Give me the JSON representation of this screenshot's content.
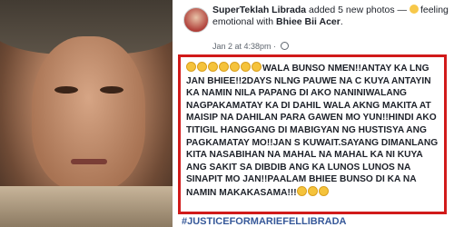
{
  "post": {
    "author": "SuperTeklah Librada",
    "action": "added 5 new photos",
    "feeling_prefix": "—",
    "feeling": "feeling emotional with",
    "tagged": "Bhiee Bii Acer",
    "timestamp": "Jan 2 at 4:38pm ·",
    "body": "WALA BUNSO NMEN!!ANTAY KA LNG JAN BHIEE!!2DAYS NLNG PAUWE NA C KUYA ANTAYIN KA NAMIN NILA PAPANG DI AKO NANINIWALANG NAGPAKAMATAY KA DI DAHIL WALA AKNG MAKITA AT MAISIP NA DAHILAN PARA GAWEN MO YUN!!HINDI AKO TITIGIL HANGGANG DI MABIGYAN NG HUSTISYA ANG PAGKAMATAY MO!!JAN S KUWAIT.SAYANG DIMANLANG KITA NASABIHAN NA MAHAL NA MAHAL KA NI KUYA ANG SAKIT SA DIBDIB ANG KA LUNOS LUNOS NA SINAPIT MO JAN!!PAALAM BHIEE BUNSO DI KA NA NAMIN MAKAKASAMA!!!",
    "hashtag": "#JUSTICEFORMARIEFELLIBRADA",
    "leading_emoji_count": 7,
    "trailing_emoji_count": 3,
    "emoji_icon": "crying-face-emoji"
  },
  "colors": {
    "highlight_border": "#d11a1a",
    "link": "#365899",
    "text": "#1d2129"
  }
}
